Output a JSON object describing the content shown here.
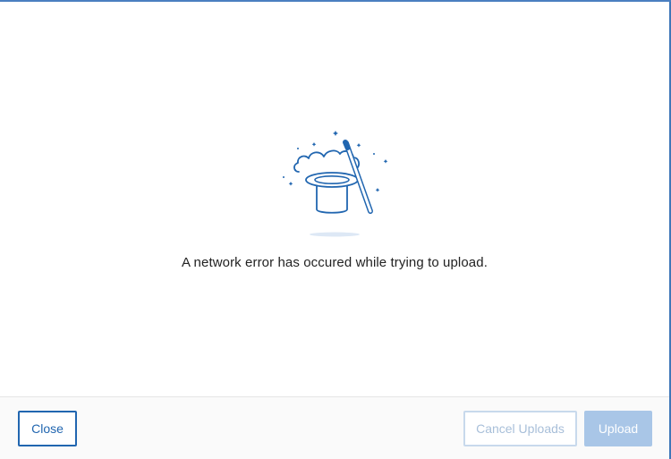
{
  "error": {
    "icon": "magic-hat-icon",
    "message": "A network error has occured while trying to upload."
  },
  "footer": {
    "close_label": "Close",
    "cancel_uploads_label": "Cancel Uploads",
    "upload_label": "Upload"
  },
  "colors": {
    "accent": "#2166b0",
    "border": "#3f77b8",
    "disabled_text": "#a8bfd9",
    "disabled_fill": "#a9c6e7"
  }
}
